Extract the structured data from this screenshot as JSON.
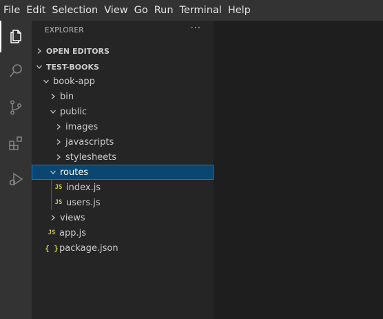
{
  "menu": [
    "File",
    "Edit",
    "Selection",
    "View",
    "Go",
    "Run",
    "Terminal",
    "Help"
  ],
  "activity_bar": {
    "icons": [
      "explorer-icon",
      "search-icon",
      "source-control-icon",
      "extensions-icon",
      "run-debug-icon"
    ],
    "active": "explorer-icon"
  },
  "sidebar": {
    "title": "EXPLORER",
    "more_actions": "···",
    "open_editors": "OPEN EDITORS",
    "workspace": "TEST-BOOKS",
    "tree": {
      "book_app": "book-app",
      "bin": "bin",
      "public": "public",
      "images": "images",
      "javascripts": "javascripts",
      "stylesheets": "stylesheets",
      "routes": "routes",
      "index_js": "index.js",
      "users_js": "users.js",
      "views": "views",
      "app_js": "app.js",
      "package_json": "package.json"
    },
    "js_icon_label": "JS",
    "json_icon_label": "{ }"
  },
  "colors": {
    "menubar_bg": "#333333",
    "activitybar_bg": "#333333",
    "sidebar_bg": "#252526",
    "editor_bg": "#1e1e1e",
    "selection_bg": "#094771",
    "js_icon": "#cbcb41"
  }
}
